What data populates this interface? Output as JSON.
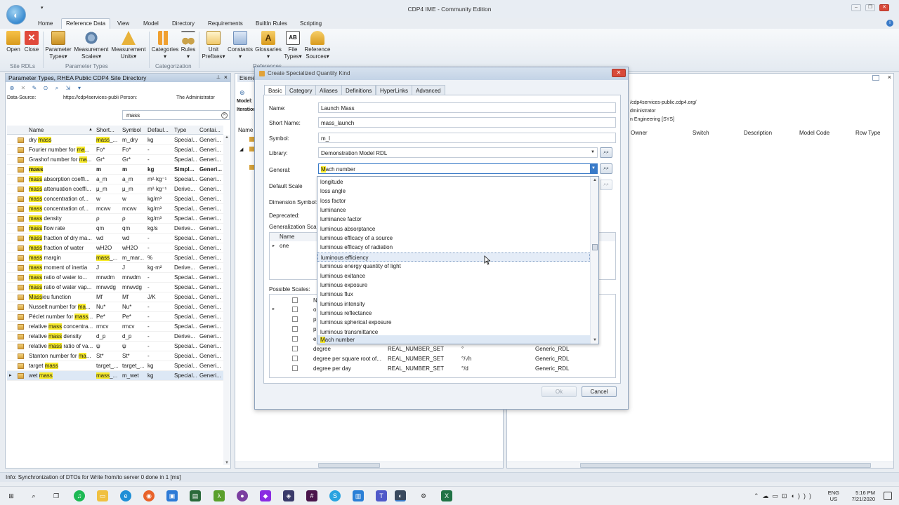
{
  "window": {
    "title": "CDP4 IME - Community Edition"
  },
  "ribbon": {
    "tabs": [
      "Home",
      "Reference Data",
      "View",
      "Model",
      "Directory",
      "Requirements",
      "BuiltIn Rules",
      "Scripting"
    ],
    "active_tab": "Reference Data",
    "buttons": {
      "open": "Open",
      "close": "Close",
      "parameter_types": [
        "Parameter",
        "Types"
      ],
      "measurement_scales": [
        "Measurement",
        "Scales"
      ],
      "measurement_units": [
        "Measurement",
        "Units"
      ],
      "categories": "Categories",
      "rules": "Rules",
      "unit_prefixes": [
        "Unit",
        "Prefixes"
      ],
      "constants": "Constants",
      "glossaries": "Glossaries",
      "file_types": [
        "File",
        "Types"
      ],
      "reference_sources": [
        "Reference",
        "Sources"
      ]
    },
    "groups": {
      "site_rdls": "Site RDLs",
      "parameter_types": "Parameter Types",
      "categorization": "Categorization",
      "references": "References"
    }
  },
  "left_panel": {
    "title": "Parameter Types, RHEA Public CDP4 Site Directory",
    "data_source_label": "Data-Source:",
    "data_source_value": "https://cdp4services-publi",
    "person_label": "Person:",
    "person_value": "The Administrator",
    "search_value": "mass",
    "columns": [
      "Name",
      "Short...",
      "Symbol",
      "Defaul...",
      "Type",
      "Contai..."
    ],
    "rows": [
      {
        "pre": "dry ",
        "hl": "mass",
        "post": "",
        "short_pre": "",
        "short_hl": "mass",
        "short_post": "_...",
        "symbol": "m_dry",
        "default": "kg",
        "type": "Special...",
        "container": "Generi..."
      },
      {
        "pre": "Fourier number for ",
        "hl": "ma",
        "post": "...",
        "short_pre": "Fo*",
        "short_hl": "",
        "short_post": "",
        "symbol": "Fo*",
        "default": "-",
        "type": "Special...",
        "container": "Generi..."
      },
      {
        "pre": "Grashof number for ",
        "hl": "ma",
        "post": "...",
        "short_pre": "Gr*",
        "short_hl": "",
        "short_post": "",
        "symbol": "Gr*",
        "default": "-",
        "type": "Special...",
        "container": "Generi..."
      },
      {
        "pre": "",
        "hl": "mass",
        "post": "",
        "short_pre": "m",
        "short_hl": "",
        "short_post": "",
        "symbol": "m",
        "default": "kg",
        "type": "Simpl...",
        "container": "Generi...",
        "bold": true
      },
      {
        "pre": "",
        "hl": "mass",
        "post": " absorption coeffi...",
        "short_pre": "a_m",
        "short_hl": "",
        "short_post": "",
        "symbol": "a_m",
        "default": "m²·kg⁻¹",
        "type": "Special...",
        "container": "Generi..."
      },
      {
        "pre": "",
        "hl": "mass",
        "post": " attenuation coeffi...",
        "short_pre": "μ_m",
        "short_hl": "",
        "short_post": "",
        "symbol": "μ_m",
        "default": "m²·kg⁻¹",
        "type": "Derive...",
        "container": "Generi..."
      },
      {
        "pre": "",
        "hl": "mass",
        "post": " concentration of...",
        "short_pre": "w",
        "short_hl": "",
        "short_post": "",
        "symbol": "w",
        "default": "kg/m³",
        "type": "Special...",
        "container": "Generi..."
      },
      {
        "pre": "",
        "hl": "mass",
        "post": " concentration of...",
        "short_pre": "mcwv",
        "short_hl": "",
        "short_post": "",
        "symbol": "mcwv",
        "default": "kg/m³",
        "type": "Special...",
        "container": "Generi..."
      },
      {
        "pre": "",
        "hl": "mass",
        "post": " density",
        "short_pre": "ρ",
        "short_hl": "",
        "short_post": "",
        "symbol": "ρ",
        "default": "kg/m³",
        "type": "Special...",
        "container": "Generi..."
      },
      {
        "pre": "",
        "hl": "mass",
        "post": " flow rate",
        "short_pre": "qm",
        "short_hl": "",
        "short_post": "",
        "symbol": "qm",
        "default": "kg/s",
        "type": "Derive...",
        "container": "Generi..."
      },
      {
        "pre": "",
        "hl": "mass",
        "post": " fraction of dry ma...",
        "short_pre": "wd",
        "short_hl": "",
        "short_post": "",
        "symbol": "wd",
        "default": "-",
        "type": "Special...",
        "container": "Generi..."
      },
      {
        "pre": "",
        "hl": "mass",
        "post": " fraction of water",
        "short_pre": "wH2O",
        "short_hl": "",
        "short_post": "",
        "symbol": "wH2O",
        "default": "-",
        "type": "Special...",
        "container": "Generi..."
      },
      {
        "pre": "",
        "hl": "mass",
        "post": " margin",
        "short_pre": "",
        "short_hl": "mass",
        "short_post": "_...",
        "symbol": "m_mar...",
        "default": "%",
        "type": "Special...",
        "container": "Generi..."
      },
      {
        "pre": "",
        "hl": "mass",
        "post": " moment of inertia",
        "short_pre": "J",
        "short_hl": "",
        "short_post": "",
        "symbol": "J",
        "default": "kg·m²",
        "type": "Derive...",
        "container": "Generi..."
      },
      {
        "pre": "",
        "hl": "mass",
        "post": " ratio of water to...",
        "short_pre": "mrwdm",
        "short_hl": "",
        "short_post": "",
        "symbol": "mrwdm",
        "default": "-",
        "type": "Special...",
        "container": "Generi..."
      },
      {
        "pre": "",
        "hl": "mass",
        "post": " ratio of water vap...",
        "short_pre": "mrwvdg",
        "short_hl": "",
        "short_post": "",
        "symbol": "mrwvdg",
        "default": "-",
        "type": "Special...",
        "container": "Generi..."
      },
      {
        "pre": "",
        "hl": "Mass",
        "post": "ieu function",
        "short_pre": "Mf",
        "short_hl": "",
        "short_post": "",
        "symbol": "Mf",
        "default": "J/K",
        "type": "Special...",
        "container": "Generi..."
      },
      {
        "pre": "Nusselt number for ",
        "hl": "ma",
        "post": "...",
        "short_pre": "Nu*",
        "short_hl": "",
        "short_post": "",
        "symbol": "Nu*",
        "default": "-",
        "type": "Special...",
        "container": "Generi..."
      },
      {
        "pre": "Péclet number for ",
        "hl": "mass",
        "post": "...",
        "short_pre": "Pe*",
        "short_hl": "",
        "short_post": "",
        "symbol": "Pe*",
        "default": "-",
        "type": "Special...",
        "container": "Generi..."
      },
      {
        "pre": "relative ",
        "hl": "mass",
        "post": " concentra...",
        "short_pre": "rmcv",
        "short_hl": "",
        "short_post": "",
        "symbol": "rmcv",
        "default": "-",
        "type": "Special...",
        "container": "Generi..."
      },
      {
        "pre": "relative ",
        "hl": "mass",
        "post": " density",
        "short_pre": "d_p",
        "short_hl": "",
        "short_post": "",
        "symbol": "d_p",
        "default": "-",
        "type": "Derive...",
        "container": "Generi..."
      },
      {
        "pre": "relative ",
        "hl": "mass",
        "post": " ratio of va...",
        "short_pre": "ψ",
        "short_hl": "",
        "short_post": "",
        "symbol": "ψ",
        "default": "-",
        "type": "Special...",
        "container": "Generi..."
      },
      {
        "pre": "Stanton number for ",
        "hl": "ma",
        "post": "...",
        "short_pre": "St*",
        "short_hl": "",
        "short_post": "",
        "symbol": "St*",
        "default": "-",
        "type": "Special...",
        "container": "Generi..."
      },
      {
        "pre": "target ",
        "hl": "mass",
        "post": "",
        "short_pre": "target_...",
        "short_hl": "",
        "short_post": "",
        "symbol": "target_...",
        "default": "kg",
        "type": "Special...",
        "container": "Generi..."
      },
      {
        "pre": "wet ",
        "hl": "mass",
        "post": "",
        "short_pre": "",
        "short_hl": "mass",
        "short_post": "_...",
        "symbol": "m_wet",
        "default": "kg",
        "type": "Special...",
        "container": "Generi...",
        "selected": true
      }
    ]
  },
  "mid_panel": {
    "tab_label": "Eleme",
    "model_label": "Model:",
    "iteration_label": "Iteration",
    "name_col": "Name"
  },
  "right_panel": {
    "url": "/cdp4services-public.cdp4.org/",
    "person": "dministrator",
    "domain": "n Engineering [SYS]",
    "columns": [
      "Owner",
      "Switch",
      "Description",
      "Model Code",
      "Row Type"
    ]
  },
  "dialog": {
    "title": "Create Specialized Quantity Kind",
    "close_label": "✕",
    "tabs": [
      "Basic",
      "Category",
      "Aliases",
      "Definitions",
      "HyperLinks",
      "Advanced"
    ],
    "active_tab": "Basic",
    "fields": {
      "name_label": "Name:",
      "name_value": "Launch Mass",
      "short_name_label": "Short Name:",
      "short_name_value": "mass_launch",
      "symbol_label": "Symbol:",
      "symbol_value": "m_l",
      "library_label": "Library:",
      "library_value": "Demonstration Model RDL",
      "general_label": "General:",
      "general_value_hl": "M",
      "general_value_rest": "ach number",
      "default_scale_label": "Default Scale",
      "dimension_symbol_label": "Dimension Symbol:",
      "deprecated_label": "Deprecated:",
      "generalization_label": "Generalization Scale",
      "possible_scales_label": "Possible Scales:"
    },
    "gen_grid": {
      "name_col": "Name",
      "row_name": "one"
    },
    "possible_rows": [
      {
        "name": "degree",
        "type": "REAL_NUMBER_SET",
        "unit": "°",
        "rdl": "Generic_RDL"
      },
      {
        "name": "degree per square root of...",
        "type": "REAL_NUMBER_SET",
        "unit": "°/√h",
        "rdl": "Generic_RDL"
      },
      {
        "name": "degree per day",
        "type": "REAL_NUMBER_SET",
        "unit": "°/d",
        "rdl": "Generic_RDL"
      }
    ],
    "partial_rows": [
      "N",
      "or",
      "pr",
      "pr",
      "er"
    ],
    "ok_label": "Ok",
    "cancel_label": "Cancel"
  },
  "dropdown": {
    "items": [
      "longitude",
      "loss angle",
      "loss factor",
      "luminance",
      "luminance factor",
      "luminous absorptance",
      "luminous efficacy of a source",
      "luminous efficacy of radiation",
      "luminous efficiency",
      "luminous energy quantity of light",
      "luminous exitance",
      "luminous exposure",
      "luminous flux",
      "luminous intensity",
      "luminous reflectance",
      "luminous spherical exposure",
      "luminous transmittance"
    ],
    "hover_item": "luminous efficiency",
    "selected_hl": "M",
    "selected_rest": "ach number"
  },
  "status": {
    "text": "Info: Synchronization of DTOs for Write from/to server 0 done in 1 [ms]"
  },
  "taskbar": {
    "lang_1": "ENG",
    "lang_2": "US",
    "time": "5:16 PM",
    "date": "7/21/2020"
  }
}
